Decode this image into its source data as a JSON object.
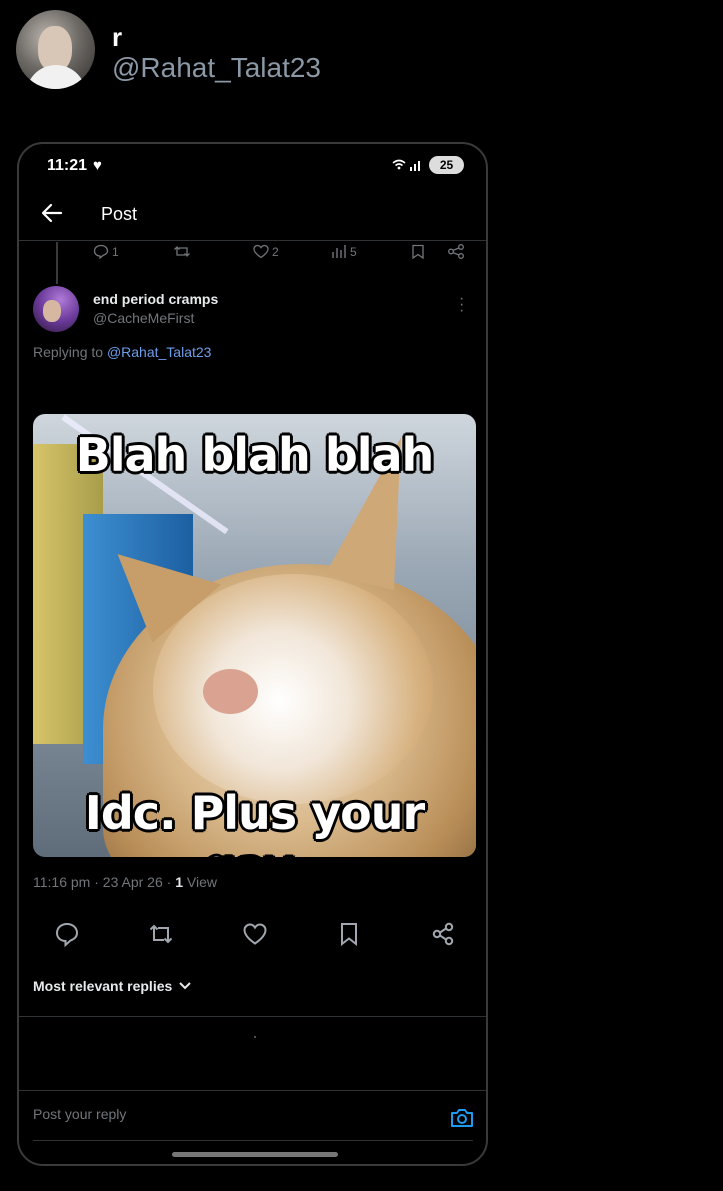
{
  "outer": {
    "name": "r",
    "handle": "@Rahat_Talat23"
  },
  "status_bar": {
    "time": "11:21",
    "heart": "♥",
    "battery": "25"
  },
  "topbar": {
    "title": "Post"
  },
  "parent_post": {
    "replies": "1",
    "likes": "2",
    "views": "5"
  },
  "reply": {
    "display_name": "end period cramps",
    "handle": "@CacheMeFirst",
    "replying_prefix": "Replying to",
    "replying_to": "@Rahat_Talat23",
    "meme_top_text": "Blah blah blah",
    "meme_bottom_text": "Idc. Plus your gay.",
    "time": "11:16 pm",
    "date": "23 Apr 26",
    "views_count": "1",
    "views_label": "View"
  },
  "sort": {
    "label": "Most relevant replies"
  },
  "composer": {
    "placeholder": "Post your reply"
  },
  "colors": {
    "accent": "#1d9bf0",
    "link": "#6d9eeb",
    "muted": "#71767b",
    "background": "#000000"
  }
}
